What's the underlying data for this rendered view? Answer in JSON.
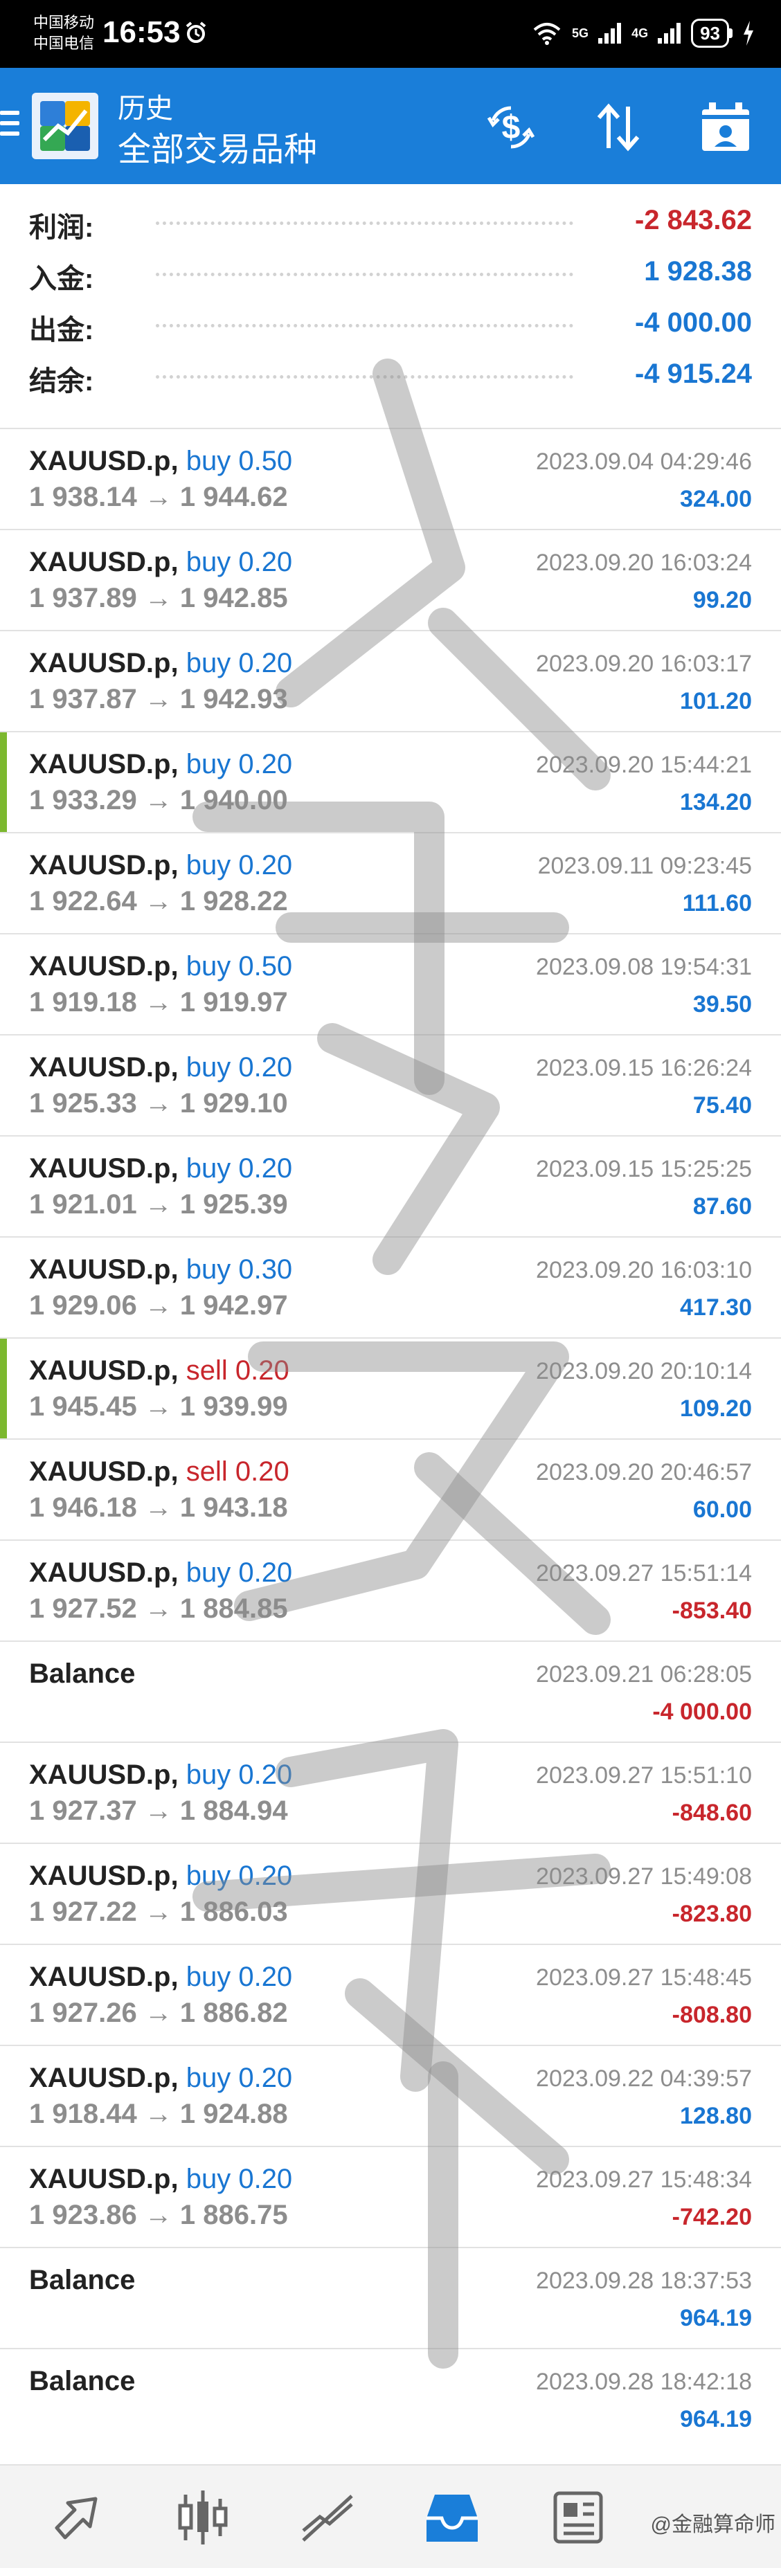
{
  "status_bar": {
    "carrier1": "中国移动",
    "carrier2": "中国电信",
    "time": "16:53",
    "net1": "5G",
    "net2": "4G",
    "battery": "93"
  },
  "header": {
    "title": "历史",
    "subtitle": "全部交易品种"
  },
  "summary": [
    {
      "label": "利润:",
      "value": "-2 843.62",
      "color": "#c8262c"
    },
    {
      "label": "入金:",
      "value": "1 928.38",
      "color": "#1976d2"
    },
    {
      "label": "出金:",
      "value": "-4 000.00",
      "color": "#1976d2"
    },
    {
      "label": "结余:",
      "value": "-4 915.24",
      "color": "#1976d2"
    }
  ],
  "trades": [
    {
      "symbol": "XAUUSD.p,",
      "side": "buy",
      "volume": "0.50",
      "prices": "1 938.14 → 1 944.62",
      "time": "2023.09.04 04:29:46",
      "profit": "324.00",
      "marked": false
    },
    {
      "symbol": "XAUUSD.p,",
      "side": "buy",
      "volume": "0.20",
      "prices": "1 937.89 → 1 942.85",
      "time": "2023.09.20 16:03:24",
      "profit": "99.20",
      "marked": false
    },
    {
      "symbol": "XAUUSD.p,",
      "side": "buy",
      "volume": "0.20",
      "prices": "1 937.87 → 1 942.93",
      "time": "2023.09.20 16:03:17",
      "profit": "101.20",
      "marked": false
    },
    {
      "symbol": "XAUUSD.p,",
      "side": "buy",
      "volume": "0.20",
      "prices": "1 933.29 → 1 940.00",
      "time": "2023.09.20 15:44:21",
      "profit": "134.20",
      "marked": true
    },
    {
      "symbol": "XAUUSD.p,",
      "side": "buy",
      "volume": "0.20",
      "prices": "1 922.64 → 1 928.22",
      "time": "2023.09.11 09:23:45",
      "profit": "111.60",
      "marked": false
    },
    {
      "symbol": "XAUUSD.p,",
      "side": "buy",
      "volume": "0.50",
      "prices": "1 919.18 → 1 919.97",
      "time": "2023.09.08 19:54:31",
      "profit": "39.50",
      "marked": false
    },
    {
      "symbol": "XAUUSD.p,",
      "side": "buy",
      "volume": "0.20",
      "prices": "1 925.33 → 1 929.10",
      "time": "2023.09.15 16:26:24",
      "profit": "75.40",
      "marked": false
    },
    {
      "symbol": "XAUUSD.p,",
      "side": "buy",
      "volume": "0.20",
      "prices": "1 921.01 → 1 925.39",
      "time": "2023.09.15 15:25:25",
      "profit": "87.60",
      "marked": false
    },
    {
      "symbol": "XAUUSD.p,",
      "side": "buy",
      "volume": "0.30",
      "prices": "1 929.06 → 1 942.97",
      "time": "2023.09.20 16:03:10",
      "profit": "417.30",
      "marked": false
    },
    {
      "symbol": "XAUUSD.p,",
      "side": "sell",
      "volume": "0.20",
      "prices": "1 945.45 → 1 939.99",
      "time": "2023.09.20 20:10:14",
      "profit": "109.20",
      "marked": true
    },
    {
      "symbol": "XAUUSD.p,",
      "side": "sell",
      "volume": "0.20",
      "prices": "1 946.18 → 1 943.18",
      "time": "2023.09.20 20:46:57",
      "profit": "60.00",
      "marked": false
    },
    {
      "symbol": "XAUUSD.p,",
      "side": "buy",
      "volume": "0.20",
      "prices": "1 927.52 → 1 884.85",
      "time": "2023.09.27 15:51:14",
      "profit": "-853.40",
      "marked": false
    },
    {
      "symbol": "Balance",
      "side": "",
      "volume": "",
      "prices": "",
      "time": "2023.09.21 06:28:05",
      "profit": "-4 000.00",
      "marked": false
    },
    {
      "symbol": "XAUUSD.p,",
      "side": "buy",
      "volume": "0.20",
      "prices": "1 927.37 → 1 884.94",
      "time": "2023.09.27 15:51:10",
      "profit": "-848.60",
      "marked": false
    },
    {
      "symbol": "XAUUSD.p,",
      "side": "buy",
      "volume": "0.20",
      "prices": "1 927.22 → 1 886.03",
      "time": "2023.09.27 15:49:08",
      "profit": "-823.80",
      "marked": false
    },
    {
      "symbol": "XAUUSD.p,",
      "side": "buy",
      "volume": "0.20",
      "prices": "1 927.26 → 1 886.82",
      "time": "2023.09.27 15:48:45",
      "profit": "-808.80",
      "marked": false
    },
    {
      "symbol": "XAUUSD.p,",
      "side": "buy",
      "volume": "0.20",
      "prices": "1 918.44 → 1 924.88",
      "time": "2023.09.22 04:39:57",
      "profit": "128.80",
      "marked": false
    },
    {
      "symbol": "XAUUSD.p,",
      "side": "buy",
      "volume": "0.20",
      "prices": "1 923.86 → 1 886.75",
      "time": "2023.09.27 15:48:34",
      "profit": "-742.20",
      "marked": false
    },
    {
      "symbol": "Balance",
      "side": "",
      "volume": "",
      "prices": "",
      "time": "2023.09.28 18:37:53",
      "profit": "964.19",
      "marked": false
    },
    {
      "symbol": "Balance",
      "side": "",
      "volume": "",
      "prices": "",
      "time": "2023.09.28 18:42:18",
      "profit": "964.19",
      "marked": false
    }
  ],
  "bottom_nav": [
    {
      "name": "nav-quotes",
      "icon": "arrows-icon",
      "active": false
    },
    {
      "name": "nav-chart",
      "icon": "candlestick-icon",
      "active": false
    },
    {
      "name": "nav-trade",
      "icon": "trend-icon",
      "active": false
    },
    {
      "name": "nav-history",
      "icon": "inbox-icon",
      "active": true
    },
    {
      "name": "nav-messages",
      "icon": "news-icon",
      "active": false
    }
  ],
  "credit": "@金融算命师",
  "colors": {
    "accent": "#1a7ed9",
    "buy": "#1976d2",
    "sell": "#c8262c",
    "marker": "#7cb82f"
  }
}
